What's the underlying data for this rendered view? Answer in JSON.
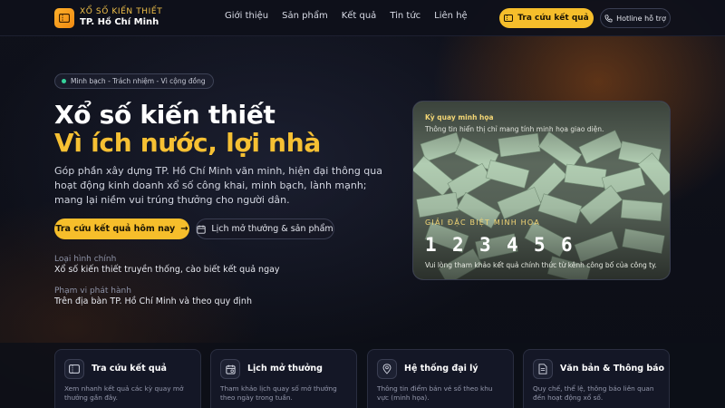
{
  "brand": {
    "line1": "XỔ SỐ KIẾN THIẾT",
    "line2": "TP. Hồ Chí Minh"
  },
  "nav": [
    {
      "label": "Giới thiệu"
    },
    {
      "label": "Sản phẩm"
    },
    {
      "label": "Kết quả"
    },
    {
      "label": "Tin tức"
    },
    {
      "label": "Liên hệ"
    }
  ],
  "header": {
    "lookup_label": "Tra cứu kết quả",
    "hotline_label": "Hotline hỗ trợ"
  },
  "hero": {
    "pill": "Minh bạch - Trách nhiệm - Vì cộng đồng",
    "title_line1": "Xổ số kiến thiết",
    "title_line2": "Vì ích nước, lợi nhà",
    "description": "Góp phần xây dựng TP. Hồ Chí Minh văn minh, hiện đại thông qua hoạt động kinh doanh xổ số công khai, minh bạch, lành mạnh; mang lại niềm vui trúng thưởng cho người dân.",
    "primary_cta": "Tra cứu kết quả hôm nay",
    "secondary_cta": "Lịch mở thưởng & sản phẩm",
    "info": [
      {
        "label": "Loại hình chính",
        "value": "Xổ số kiến thiết truyền thống, cào biết kết quả ngay"
      },
      {
        "label": "Phạm vi phát hành",
        "value": "Trên địa bàn TP. Hồ Chí Minh và theo quy định"
      }
    ]
  },
  "feature": {
    "title": "Kỳ quay minh họa",
    "subtitle": "Thông tin hiển thị chỉ mang tính minh họa giao diện.",
    "prize_label": "GIẢI ĐẶC BIỆT MINH HỌA",
    "digits": [
      "1",
      "2",
      "3",
      "4",
      "5",
      "6"
    ],
    "note": "Vui lòng tham khảo kết quả chính thức từ kênh công bố của công ty."
  },
  "cards": [
    {
      "title": "Tra cứu kết quả",
      "description": "Xem nhanh kết quả các kỳ quay mở thưởng gần đây.",
      "icon": "ticket-icon"
    },
    {
      "title": "Lịch mở thưởng",
      "description": "Tham khảo lịch quay số mở thưởng theo ngày trong tuần.",
      "icon": "calendar-icon"
    },
    {
      "title": "Hệ thống đại lý",
      "description": "Thông tin điểm bán vé số theo khu vực (minh họa).",
      "icon": "map-pin-icon"
    },
    {
      "title": "Văn bản & Thông báo",
      "description": "Quy chế, thể lệ, thông báo liên quan đến hoạt động xổ số.",
      "icon": "document-icon"
    }
  ],
  "colors": {
    "accent": "#f6be2b",
    "background": "#0c0e16",
    "status_dot": "#35d39b"
  }
}
